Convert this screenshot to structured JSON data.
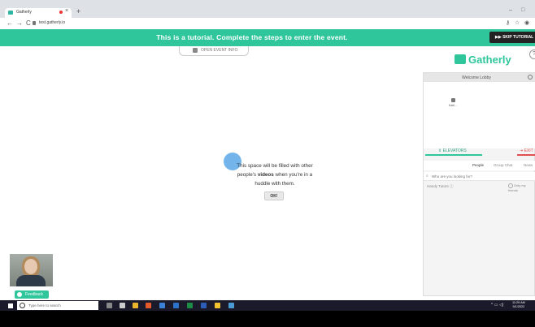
{
  "browser": {
    "tab_title": "Gatherly",
    "tab_close": "×",
    "new_tab": "+",
    "url": "test.gatherly.io",
    "nav_back": "←",
    "nav_forward": "→",
    "nav_reload": "C",
    "minimize": "–",
    "maximize": "□",
    "star": "☆"
  },
  "banner": {
    "text": "This is a tutorial. Complete the steps to enter the event.",
    "skip_label": "▶▶ SKIP TUTORIAL"
  },
  "event_info": {
    "label": "OPEN EVENT INFO"
  },
  "tutorial": {
    "line1": "This space will be filled with other",
    "line2_pre": "people's ",
    "line2_bold": "videos",
    "line2_post": " when you're in a",
    "line3": "huddle with them.",
    "ok_label": "OK!"
  },
  "feedback": {
    "label": "Feedback"
  },
  "sidebar": {
    "logo_text": "Gatherly",
    "help": "?",
    "lobby_title": "Welcome Lobby",
    "avatar_label": "Kaitl...",
    "elevators_label": "⇕ ELEVATORS",
    "exit_label": "⇥ EXIT",
    "tabs": [
      "People",
      "Group Chat",
      "News"
    ],
    "search_placeholder": "Who are you looking for?",
    "handy_tutors": "Handy Tutors ⓘ",
    "only_friends": "Only my friends"
  },
  "taskbar": {
    "search_placeholder": "Type here to search",
    "time": "11:29 AM",
    "date": "9/1/2022"
  }
}
